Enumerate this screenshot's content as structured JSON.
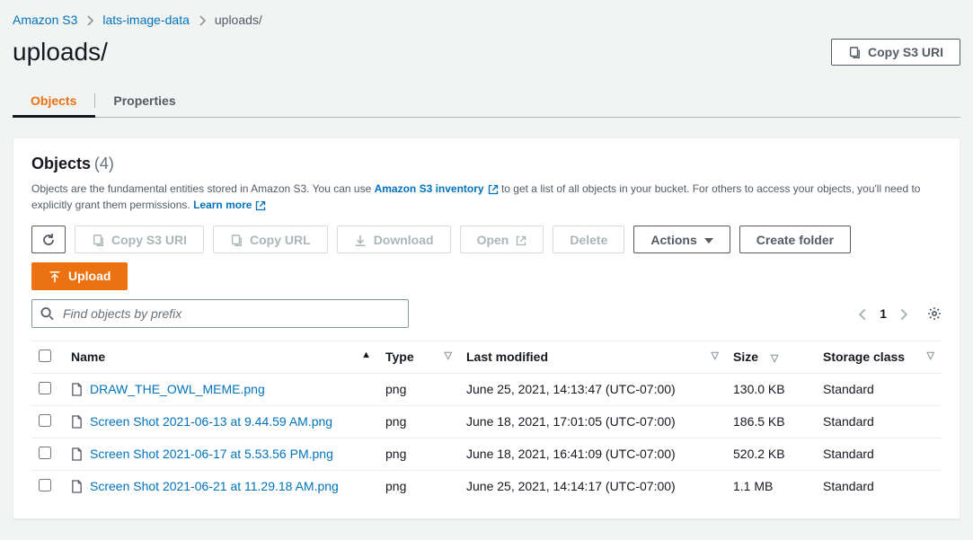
{
  "breadcrumb": {
    "root": "Amazon S3",
    "bucket": "lats-image-data",
    "prefix": "uploads/"
  },
  "header": {
    "title": "uploads/",
    "copy_uri_label": "Copy S3 URI"
  },
  "tabs": {
    "objects": "Objects",
    "properties": "Properties"
  },
  "objects_panel": {
    "title": "Objects",
    "count_display": "(4)",
    "desc_pre": "Objects are the fundamental entities stored in Amazon S3. You can use ",
    "inventory_link": "Amazon S3 inventory",
    "desc_mid": " to get a list of all objects in your bucket. For others to access your objects, you'll need to explicitly grant them permissions. ",
    "learn_more": "Learn more"
  },
  "buttons": {
    "copy_uri": "Copy S3 URI",
    "copy_url": "Copy URL",
    "download": "Download",
    "open": "Open",
    "delete": "Delete",
    "actions": "Actions",
    "create_folder": "Create folder",
    "upload": "Upload"
  },
  "search": {
    "placeholder": "Find objects by prefix"
  },
  "pager": {
    "page": "1"
  },
  "columns": {
    "name": "Name",
    "type": "Type",
    "last_modified": "Last modified",
    "size": "Size",
    "storage_class": "Storage class"
  },
  "rows": [
    {
      "name": "DRAW_THE_OWL_MEME.png",
      "type": "png",
      "modified": "June 25, 2021, 14:13:47 (UTC-07:00)",
      "size": "130.0 KB",
      "class": "Standard"
    },
    {
      "name": "Screen Shot 2021-06-13 at 9.44.59 AM.png",
      "type": "png",
      "modified": "June 18, 2021, 17:01:05 (UTC-07:00)",
      "size": "186.5 KB",
      "class": "Standard"
    },
    {
      "name": "Screen Shot 2021-06-17 at 5.53.56 PM.png",
      "type": "png",
      "modified": "June 18, 2021, 16:41:09 (UTC-07:00)",
      "size": "520.2 KB",
      "class": "Standard"
    },
    {
      "name": "Screen Shot 2021-06-21 at 11.29.18 AM.png",
      "type": "png",
      "modified": "June 25, 2021, 14:14:17 (UTC-07:00)",
      "size": "1.1 MB",
      "class": "Standard"
    }
  ]
}
